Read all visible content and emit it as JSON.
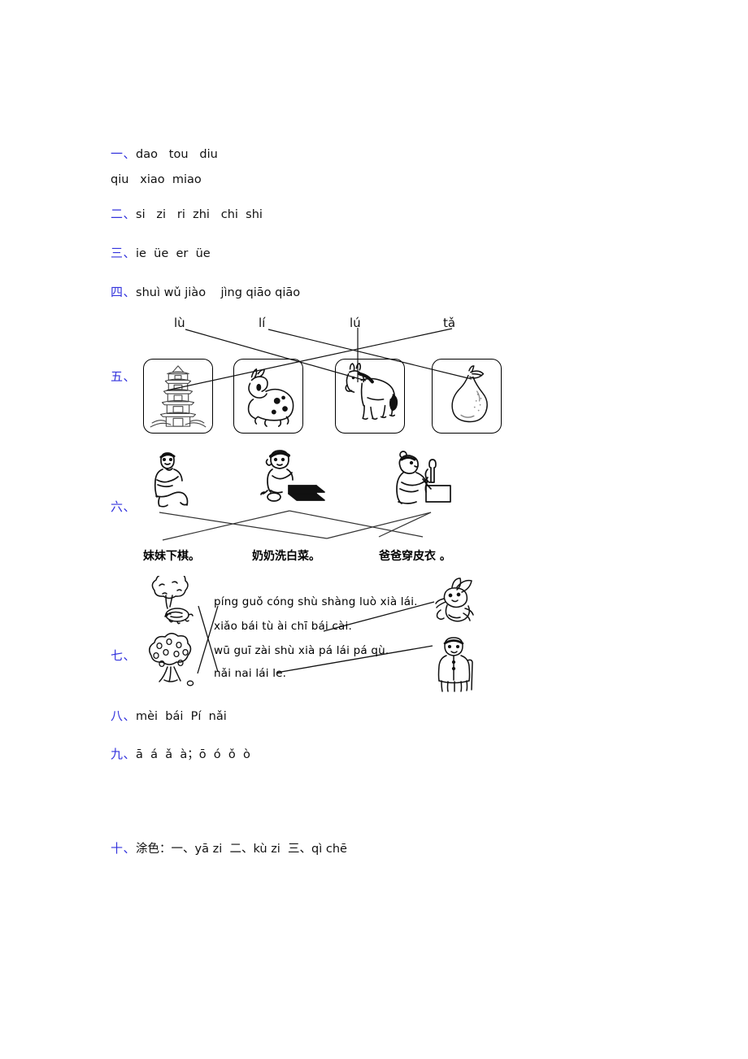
{
  "document": {
    "kind": "pinyin-worksheet-answer-key",
    "page_background": "#ffffff",
    "number_color": "#3333dd",
    "text_color": "#111111"
  },
  "sections": {
    "one": {
      "num": "一、",
      "line1": "dao   tou   diu",
      "line2": "qiu   xiao  miao"
    },
    "two": {
      "num": "二、",
      "line1": "si   zi   ri  zhi   chi  shi"
    },
    "three": {
      "num": "三、",
      "line1": "ie  üe  er  üe"
    },
    "four": {
      "num": "四、",
      "line1": "shuì wǔ jiào    jìng qiāo qiāo"
    },
    "five": {
      "num": "五、",
      "words": [
        {
          "text": "lù"
        },
        {
          "text": "lí"
        },
        {
          "text": "lú"
        },
        {
          "text": "tǎ"
        }
      ],
      "pictures": [
        {
          "name": "pagoda-tower"
        },
        {
          "name": "deer"
        },
        {
          "name": "donkey"
        },
        {
          "name": "pear"
        }
      ]
    },
    "six": {
      "num": "六、",
      "figures": [
        {
          "name": "man-sitting"
        },
        {
          "name": "child-playing-chess"
        },
        {
          "name": "grandma-washing-vegetables"
        }
      ],
      "captions": [
        {
          "text": "妹妹下棋。"
        },
        {
          "text": "奶奶洗白菜。"
        },
        {
          "text": "爸爸穿皮衣 。"
        }
      ]
    },
    "seven": {
      "num": "七、",
      "sentences": [
        {
          "text": "píng guǒ cóng shù shàng luò xià lái."
        },
        {
          "text": "xiǎo bái tù ài chī bái cài."
        },
        {
          "text": "wū guī zài shù xià pá lái pá qù."
        },
        {
          "text": "nǎi nai lái le."
        }
      ],
      "figures": [
        {
          "name": "tree-with-turtle"
        },
        {
          "name": "apple-tree"
        },
        {
          "name": "rabbit"
        },
        {
          "name": "grandmother-with-cane"
        }
      ]
    },
    "eight": {
      "num": "八、",
      "line1": "mèi  bái  Pí  nǎi"
    },
    "nine": {
      "num": "九、",
      "line1": "ā  á  ǎ  à；ō  ó  ǒ  ò"
    },
    "ten": {
      "num": "十、",
      "line1": "涂色：一、yā zi  二、kù zi  三、qì chē"
    }
  }
}
